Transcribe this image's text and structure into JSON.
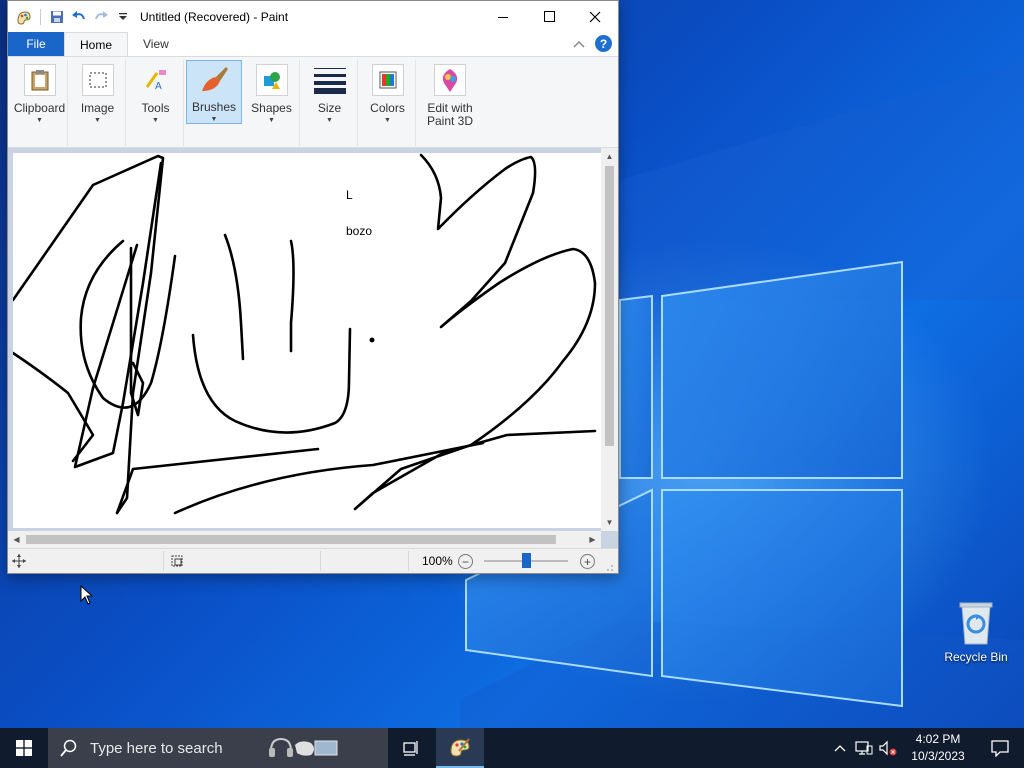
{
  "window": {
    "title": "Untitled (Recovered) - Paint"
  },
  "tabs": {
    "file": "File",
    "home": "Home",
    "view": "View",
    "help": "?"
  },
  "ribbon": {
    "groups": [
      {
        "label": "Clipboard",
        "icon": "clipboard-icon"
      },
      {
        "label": "Image",
        "icon": "select-icon"
      },
      {
        "label": "Tools",
        "icon": "tools-icon"
      },
      {
        "label": "Brushes",
        "icon": "brush-icon"
      },
      {
        "label": "Shapes",
        "icon": "shapes-icon"
      },
      {
        "label": "Size",
        "icon": "size-icon"
      },
      {
        "label": "Colors",
        "icon": "colors-icon"
      },
      {
        "label": "Edit with Paint 3D",
        "icon": "paint3d-icon"
      }
    ]
  },
  "canvas": {
    "text_1": "L",
    "text_2": "bozo"
  },
  "statusbar": {
    "zoom": "100%",
    "zoom_level_percent": 100
  },
  "desktop": {
    "recycle_bin": "Recycle Bin"
  },
  "taskbar": {
    "search_placeholder": "Type here to search",
    "time": "4:02 PM",
    "date": "10/3/2023"
  },
  "colors": {
    "accent": "#1a65c8",
    "taskbar": "#101b2e"
  }
}
